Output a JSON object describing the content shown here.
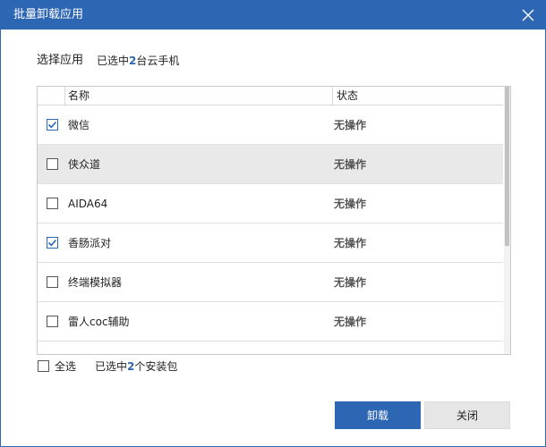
{
  "window": {
    "title": "批量卸载应用"
  },
  "header": {
    "label": "选择应用",
    "selected_prefix": "已选中",
    "selected_count": "2",
    "selected_suffix": "台云手机"
  },
  "table": {
    "columns": [
      "名称",
      "状态"
    ],
    "rows": [
      {
        "name": "微信",
        "status": "无操作",
        "checked": true
      },
      {
        "name": "侠众道",
        "status": "无操作",
        "checked": false
      },
      {
        "name": "AIDA64",
        "status": "无操作",
        "checked": false
      },
      {
        "name": "香肠派对",
        "status": "无操作",
        "checked": true
      },
      {
        "name": "终端模拟器",
        "status": "无操作",
        "checked": false
      },
      {
        "name": "雷人coc辅助",
        "status": "无操作",
        "checked": false
      }
    ]
  },
  "footer": {
    "select_all_label": "全选",
    "pkg_prefix": "已选中",
    "pkg_count": "2",
    "pkg_suffix": "个安装包"
  },
  "buttons": {
    "uninstall": "卸载",
    "close": "关闭"
  },
  "colors": {
    "accent": "#2d66b3",
    "hover_row": "#e9e9e9"
  },
  "icons": {
    "close": "close-icon",
    "check": "checkmark-icon"
  }
}
